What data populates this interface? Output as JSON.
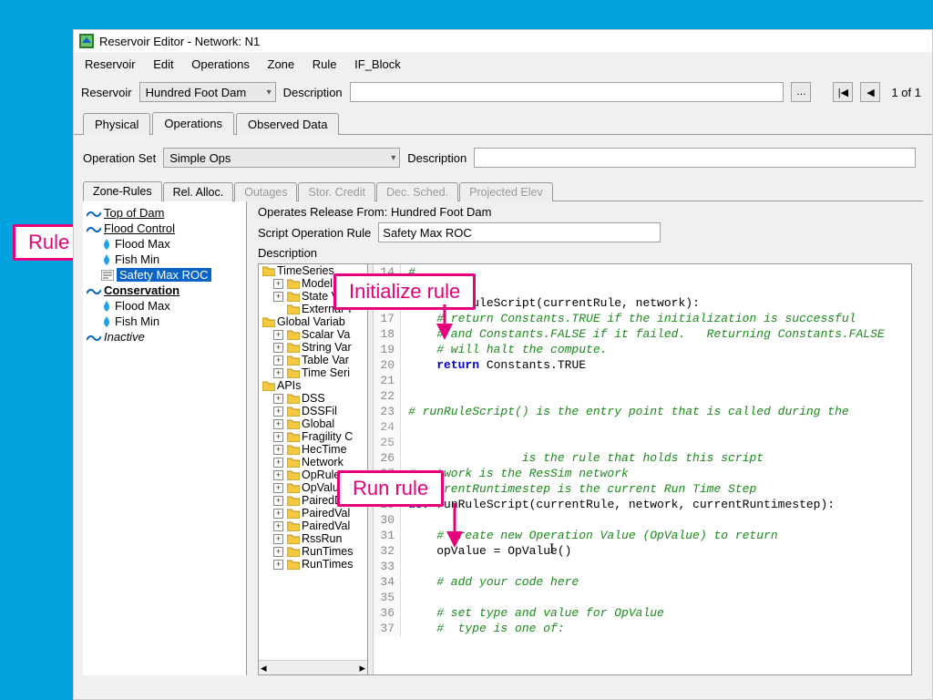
{
  "window": {
    "title": "Reservoir Editor - Network: N1"
  },
  "menu": {
    "items": [
      "Reservoir",
      "Edit",
      "Operations",
      "Zone",
      "Rule",
      "IF_Block"
    ]
  },
  "top": {
    "reservoir_label": "Reservoir",
    "reservoir_value": "Hundred Foot Dam",
    "description_label": "Description",
    "description_value": "",
    "pager": "1 of 1"
  },
  "tabs": {
    "physical": "Physical",
    "operations": "Operations",
    "observed": "Observed Data"
  },
  "ops": {
    "opset_label": "Operation Set",
    "opset_value": "Simple Ops",
    "opset_desc_label": "Description",
    "opset_desc_value": ""
  },
  "subtabs": {
    "zone_rules": "Zone-Rules",
    "rel_alloc": "Rel. Alloc.",
    "outages": "Outages",
    "stor_credit": "Stor. Credit",
    "dec_sched": "Dec. Sched.",
    "proj_elev": "Projected Elev"
  },
  "rule_tree": {
    "top": "Top of Dam",
    "flood_control": "Flood Control",
    "flood_max": "Flood Max",
    "fish_min": "Fish Min",
    "safety": "Safety Max ROC",
    "conservation": "Conservation",
    "flood_max2": "Flood Max",
    "fish_min2": "Fish Min",
    "inactive": "Inactive"
  },
  "release": {
    "from_label": "Operates Release From: Hundred Foot Dam",
    "rule_label": "Script Operation Rule",
    "rule_name": "Safety Max ROC",
    "desc_label": "Description"
  },
  "api_tree": {
    "timeseries": "TimeSeries",
    "model_var": "Model Var",
    "state_var": "State Vari",
    "external_t": "External T",
    "global_var": "Global Variab",
    "scalar": "Scalar Va",
    "string": "String Var",
    "table": "Table Var",
    "timeseri": "Time Seri",
    "apis": "APIs",
    "dss": "DSS",
    "dssfi": "DSSFil",
    "global": "Global",
    "fragility": "Fragility C",
    "hectime": "HecTime",
    "network": "Network",
    "oprule": "OpRule",
    "opvalue": "OpValue",
    "paireddat": "PairedDat",
    "pairedval": "PairedVal",
    "pairedval2": "PairedVal",
    "rssrun": "RssRun",
    "runtimes": "RunTimes",
    "runtimes2": "RunTimes"
  },
  "code": {
    "l14": "#",
    "l15": "#",
    "l16a": "def ",
    "l16b": "initRuleScript(currentRule, network):",
    "l17": "    # return Constants.TRUE if the initialization is successful",
    "l18": "    # and Constants.FALSE if it failed.   Returning Constants.FALSE",
    "l19": "    # will halt the compute.",
    "l20a": "    ",
    "l20b": "return ",
    "l20c": "Constants.TRUE",
    "l21": "",
    "l22": "",
    "l23": "# runRuleScript() is the entry point that is called during the",
    "l26": "                is the rule that holds this script",
    "l27": "# network is the ResSim network",
    "l28": "# currentRuntimestep is the current Run Time Step",
    "l29a": "def ",
    "l29b": "runRuleScript(currentRule, network, currentRuntimestep):",
    "l30": "",
    "l31": "    # create new Operation Value (OpValue) to return",
    "l32": "    opValue = OpValue()",
    "l33": "",
    "l34": "    # add your code here",
    "l35": "",
    "l36": "    # set type and value for OpValue",
    "l37": "    #  type is one of:"
  },
  "callouts": {
    "rule": "Rule",
    "init": "Initialize rule",
    "run": "Run rule"
  }
}
